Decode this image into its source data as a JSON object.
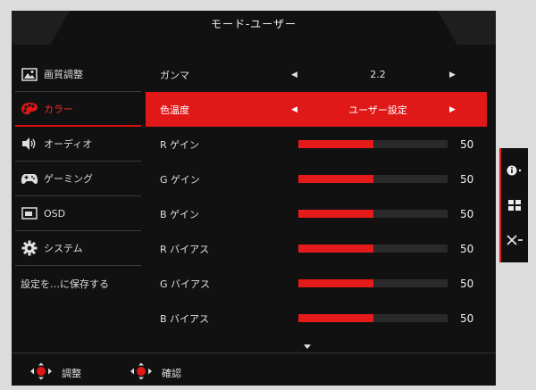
{
  "title": "モード-ユーザー",
  "sidebar": {
    "items": [
      {
        "label": "画質調整",
        "icon": "picture-icon"
      },
      {
        "label": "カラー",
        "icon": "palette-icon",
        "active": true
      },
      {
        "label": "オーディオ",
        "icon": "speaker-icon"
      },
      {
        "label": "ゲーミング",
        "icon": "gamepad-icon"
      },
      {
        "label": "OSD",
        "icon": "osd-icon"
      },
      {
        "label": "システム",
        "icon": "gear-icon"
      },
      {
        "label": "設定を…に保存する",
        "icon": ""
      }
    ]
  },
  "settings": {
    "gamma": {
      "label": "ガンマ",
      "value": "2.2"
    },
    "color_temp": {
      "label": "色温度",
      "value": "ユーザー設定"
    },
    "r_gain": {
      "label": "R ゲイン",
      "value": "50",
      "level": 0.5
    },
    "g_gain": {
      "label": "G ゲイン",
      "value": "50",
      "level": 0.5
    },
    "b_gain": {
      "label": "B ゲイン",
      "value": "50",
      "level": 0.5
    },
    "r_bias": {
      "label": "R バイアス",
      "value": "50",
      "level": 0.5
    },
    "g_bias": {
      "label": "G バイアス",
      "value": "50",
      "level": 0.5
    },
    "b_bias": {
      "label": "B バイアス",
      "value": "50",
      "level": 0.5
    }
  },
  "footer": {
    "adjust_label": "調整",
    "confirm_label": "確認"
  },
  "side_panel": {
    "buttons": [
      "info-icon",
      "menu-grid-icon",
      "close-icon"
    ]
  },
  "colors": {
    "accent": "#e01818",
    "background": "#111111",
    "bar_fill": "#e51b1b"
  }
}
